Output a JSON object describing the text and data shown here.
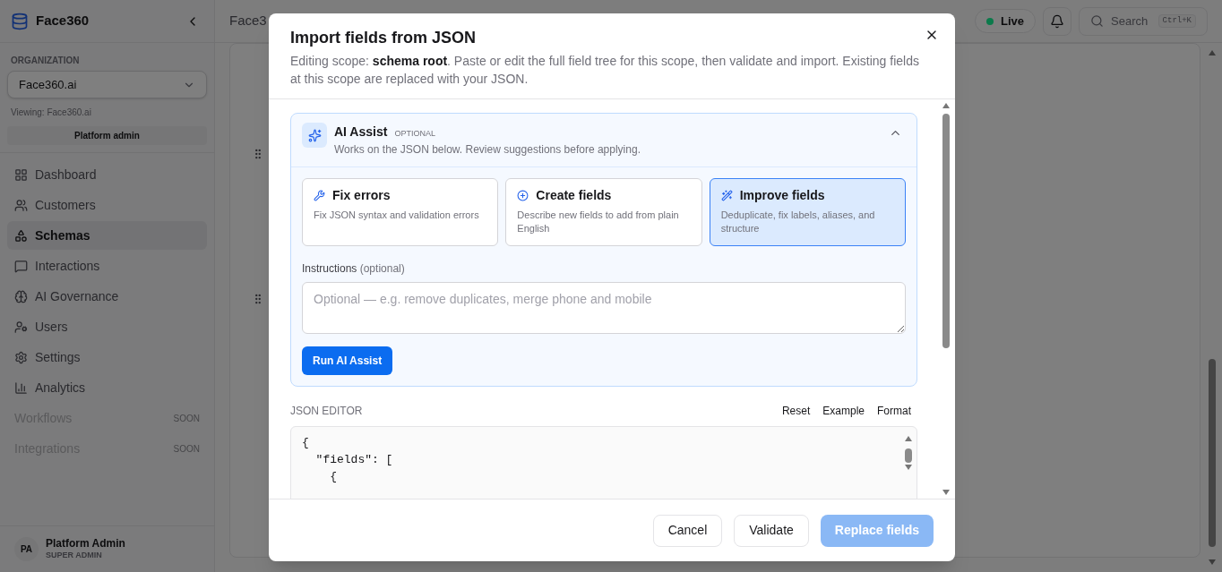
{
  "sidebar": {
    "brand": "Face360",
    "org_label": "ORGANIZATION",
    "org_select": "Face360.ai",
    "viewing": "Viewing: Face360.ai",
    "role_badge": "Platform admin",
    "nav": [
      {
        "label": "Dashboard",
        "selected": false,
        "disabled": false
      },
      {
        "label": "Customers",
        "selected": false,
        "disabled": false
      },
      {
        "label": "Schemas",
        "selected": true,
        "disabled": false
      },
      {
        "label": "Interactions",
        "selected": false,
        "disabled": false
      },
      {
        "label": "AI Governance",
        "selected": false,
        "disabled": false
      },
      {
        "label": "Users",
        "selected": false,
        "disabled": false
      },
      {
        "label": "Settings",
        "selected": false,
        "disabled": false
      },
      {
        "label": "Analytics",
        "selected": false,
        "disabled": false
      },
      {
        "label": "Workflows",
        "selected": false,
        "disabled": true,
        "tag": "SOON"
      },
      {
        "label": "Integrations",
        "selected": false,
        "disabled": true,
        "tag": "SOON"
      }
    ],
    "user": {
      "initials": "PA",
      "name": "Platform Admin",
      "role": "SUPER ADMIN"
    }
  },
  "topbar": {
    "breadcrumb": "Face3",
    "status": {
      "label": "Live",
      "color": "#0b7a4b"
    },
    "search": {
      "placeholder": "Search",
      "shortcut": "Ctrl+K"
    }
  },
  "dialog": {
    "title": "Import fields from JSON",
    "description": "Editing scope: **schema root**. Paste or edit the full field tree for this scope, then validate and import. Existing fields at this scope are replaced with your JSON.",
    "ai_assist": {
      "title": "AI Assist",
      "tag": "OPTIONAL",
      "subtitle": "Works on the JSON below. Review suggestions before applying.",
      "expanded": true,
      "actions": [
        {
          "title": "Fix errors",
          "description": "Fix JSON syntax and validation errors",
          "selected": false
        },
        {
          "title": "Create fields",
          "description": "Describe new fields to add from plain English",
          "selected": false
        },
        {
          "title": "Improve fields",
          "description": "Deduplicate, fix labels, aliases, and structure",
          "selected": true
        }
      ],
      "instructions_label": "Instructions",
      "instructions_hint": "(optional)",
      "instructions_placeholder": "Optional — e.g. remove duplicates, merge phone and mobile",
      "run_button": "Run AI Assist"
    },
    "editor": {
      "label": "JSON EDITOR",
      "actions": [
        "Reset",
        "Example",
        "Format"
      ],
      "lines": [
        "{",
        "  \"fields\": [",
        "    {"
      ]
    },
    "footer": [
      {
        "label": "Cancel",
        "kind": "secondary",
        "disabled": false
      },
      {
        "label": "Validate",
        "kind": "secondary",
        "disabled": false
      },
      {
        "label": "Replace fields",
        "kind": "primary",
        "disabled": true
      }
    ]
  }
}
